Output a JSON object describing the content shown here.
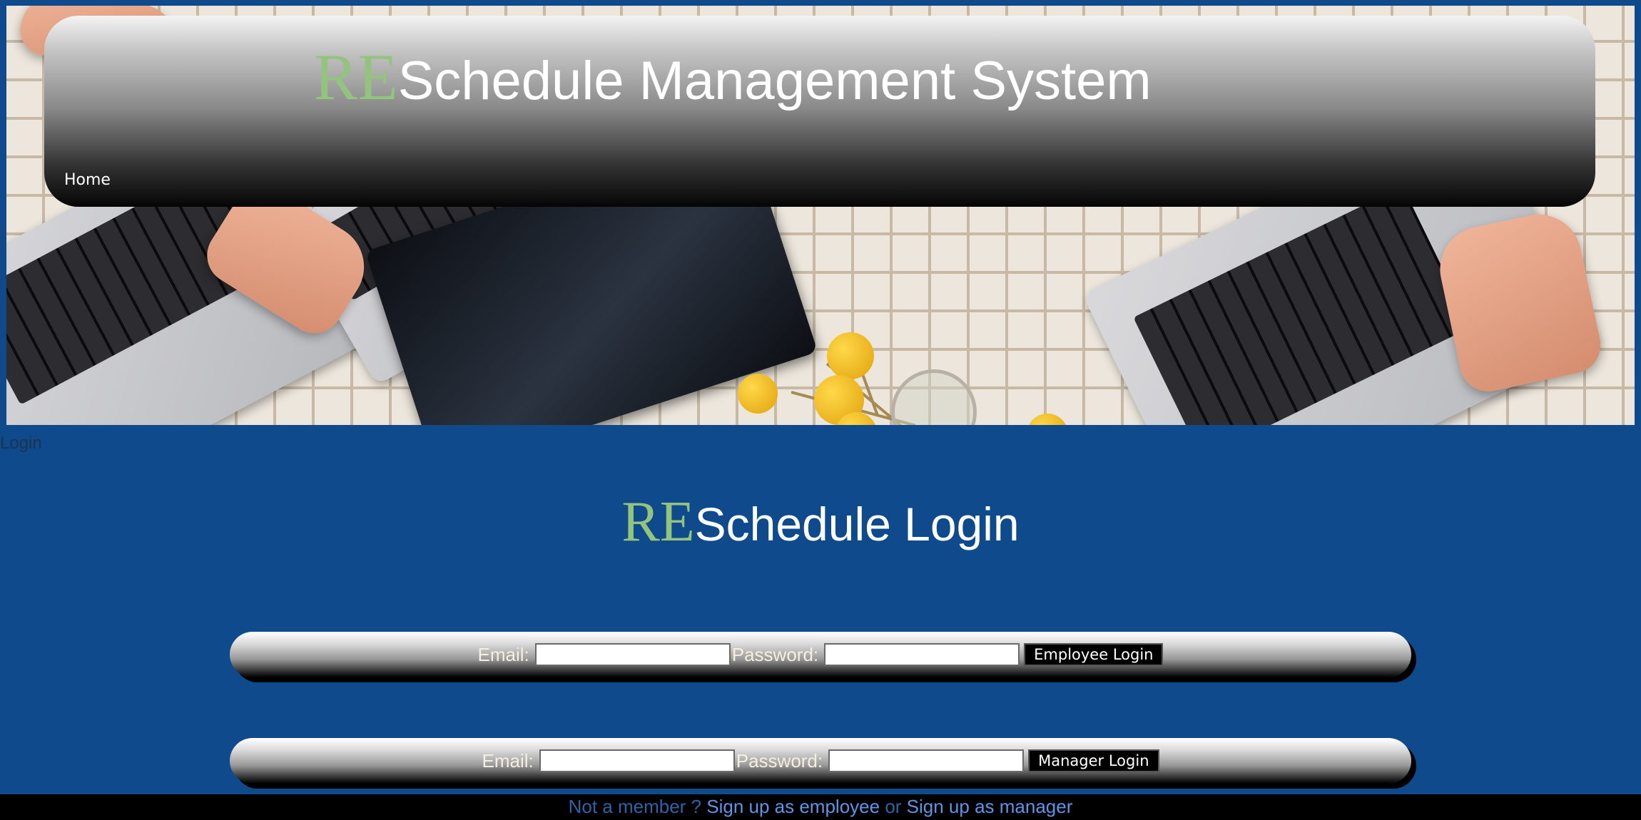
{
  "header": {
    "title_accent": "RE",
    "title_rest": "Schedule Management System",
    "nav": [
      {
        "label": "Home"
      }
    ]
  },
  "page_label": "Login",
  "login": {
    "title_accent": "RE",
    "title_rest": "Schedule Login",
    "employee": {
      "email_label": "Email:",
      "email_value": "",
      "password_label": "Password:",
      "password_value": "",
      "button_label": "Employee Login"
    },
    "manager": {
      "email_label": "Email:",
      "email_value": "",
      "password_label": "Password:",
      "password_value": "",
      "button_label": "Manager Login"
    }
  },
  "footer": {
    "prompt": "Not a member ?",
    "employee_link": "Sign up as employee",
    "separator": "or",
    "manager_link": "Sign up as manager"
  },
  "colors": {
    "page_background": "#0f4a8c",
    "accent_green": "#93c47d",
    "footer_background": "#000000",
    "footer_link": "#5f94e6"
  }
}
